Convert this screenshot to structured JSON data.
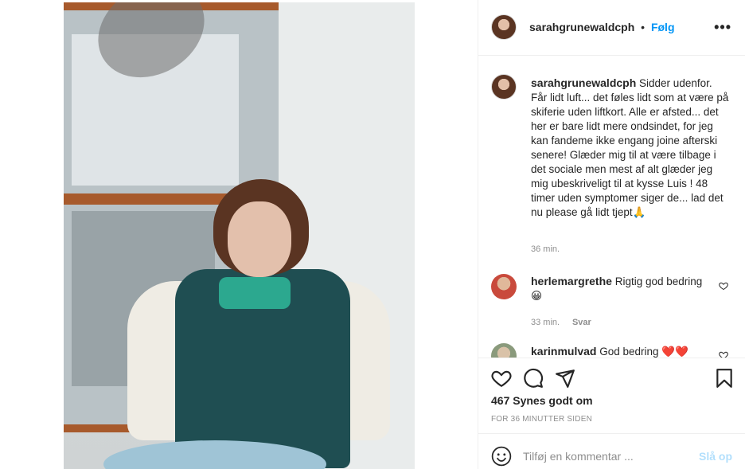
{
  "post": {
    "username": "sarahgrunewaldcph",
    "separator": "•",
    "follow_label": "Følg",
    "more_icon": "more-options-icon",
    "image_alt": "Woman in white sweater and teal puffer vest sitting by a window"
  },
  "caption": {
    "username": "sarahgrunewaldcph",
    "text": "Sidder udenfor. Får lidt luft... det føles lidt som at være på skiferie uden liftkort. Alle er afsted... det her er bare lidt mere ondsindet, for jeg kan fandeme ikke engang joine afterski senere! Glæder mig til at være tilbage i det sociale men mest af alt glæder jeg mig ubeskriveligt til at kysse Luis ! 48 timer uden symptomer siger de... lad det nu please gå lidt tjept🙏",
    "time": "36 min."
  },
  "comments": [
    {
      "username": "herlemargrethe",
      "text": "Rigtig god bedring😀",
      "time": "33 min.",
      "reply_label": "Svar"
    },
    {
      "username": "karinmulvad",
      "text": "God bedring ❤️❤️"
    }
  ],
  "actions": {
    "likes": "467 Synes godt om",
    "timestamp": "FOR 36 MINUTTER SIDEN"
  },
  "add_comment": {
    "placeholder": "Tilføj en kommentar ...",
    "post_label": "Slå op"
  },
  "colors": {
    "accent": "#0095f6",
    "post_disabled": "#b2dffc",
    "muted": "#8e8e8e",
    "border": "#efefef"
  }
}
